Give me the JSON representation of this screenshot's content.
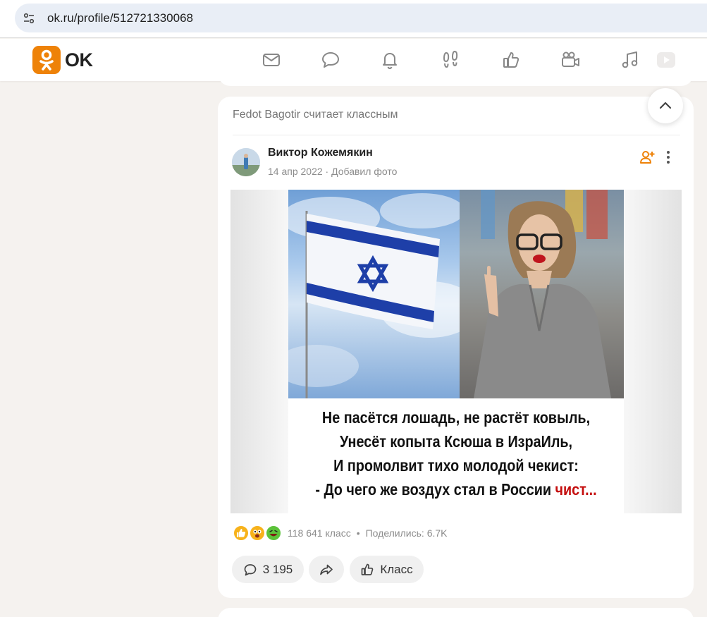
{
  "browser": {
    "url": "ok.ru/profile/512721330068",
    "site_info_icon": "tune-icon"
  },
  "header": {
    "logo_text": "OK",
    "brand_color": "#ee8208",
    "nav_icons": [
      "mail-icon",
      "chat-icon",
      "bell-icon",
      "footprints-icon",
      "like-icon",
      "video-camera-icon",
      "music-icon",
      "video-play-icon"
    ]
  },
  "feed": {
    "post": {
      "reason": "Fedot Bagotir считает классным",
      "author": "Виктор Кожемякин",
      "meta": "14 апр 2022 · Добавил фото",
      "image_caption": {
        "line1": "Не пасётся лошадь, не растёт ковыль,",
        "line2": "Унесёт копыта Ксюша в ИзраИль,",
        "line3": "И промолвит тихо молодой чекист:",
        "line4_prefix": "- До чего же воздух стал в России ",
        "line4_red": "чист..."
      },
      "reactions": {
        "emojis": [
          "like-emoji",
          "wow-emoji",
          "laugh-emoji"
        ],
        "klass_count": "118 641 класс",
        "separator": "•",
        "shares": "Поделились: 6.7K"
      },
      "actions": {
        "comments": "3 195",
        "klass": "Класс"
      }
    }
  }
}
